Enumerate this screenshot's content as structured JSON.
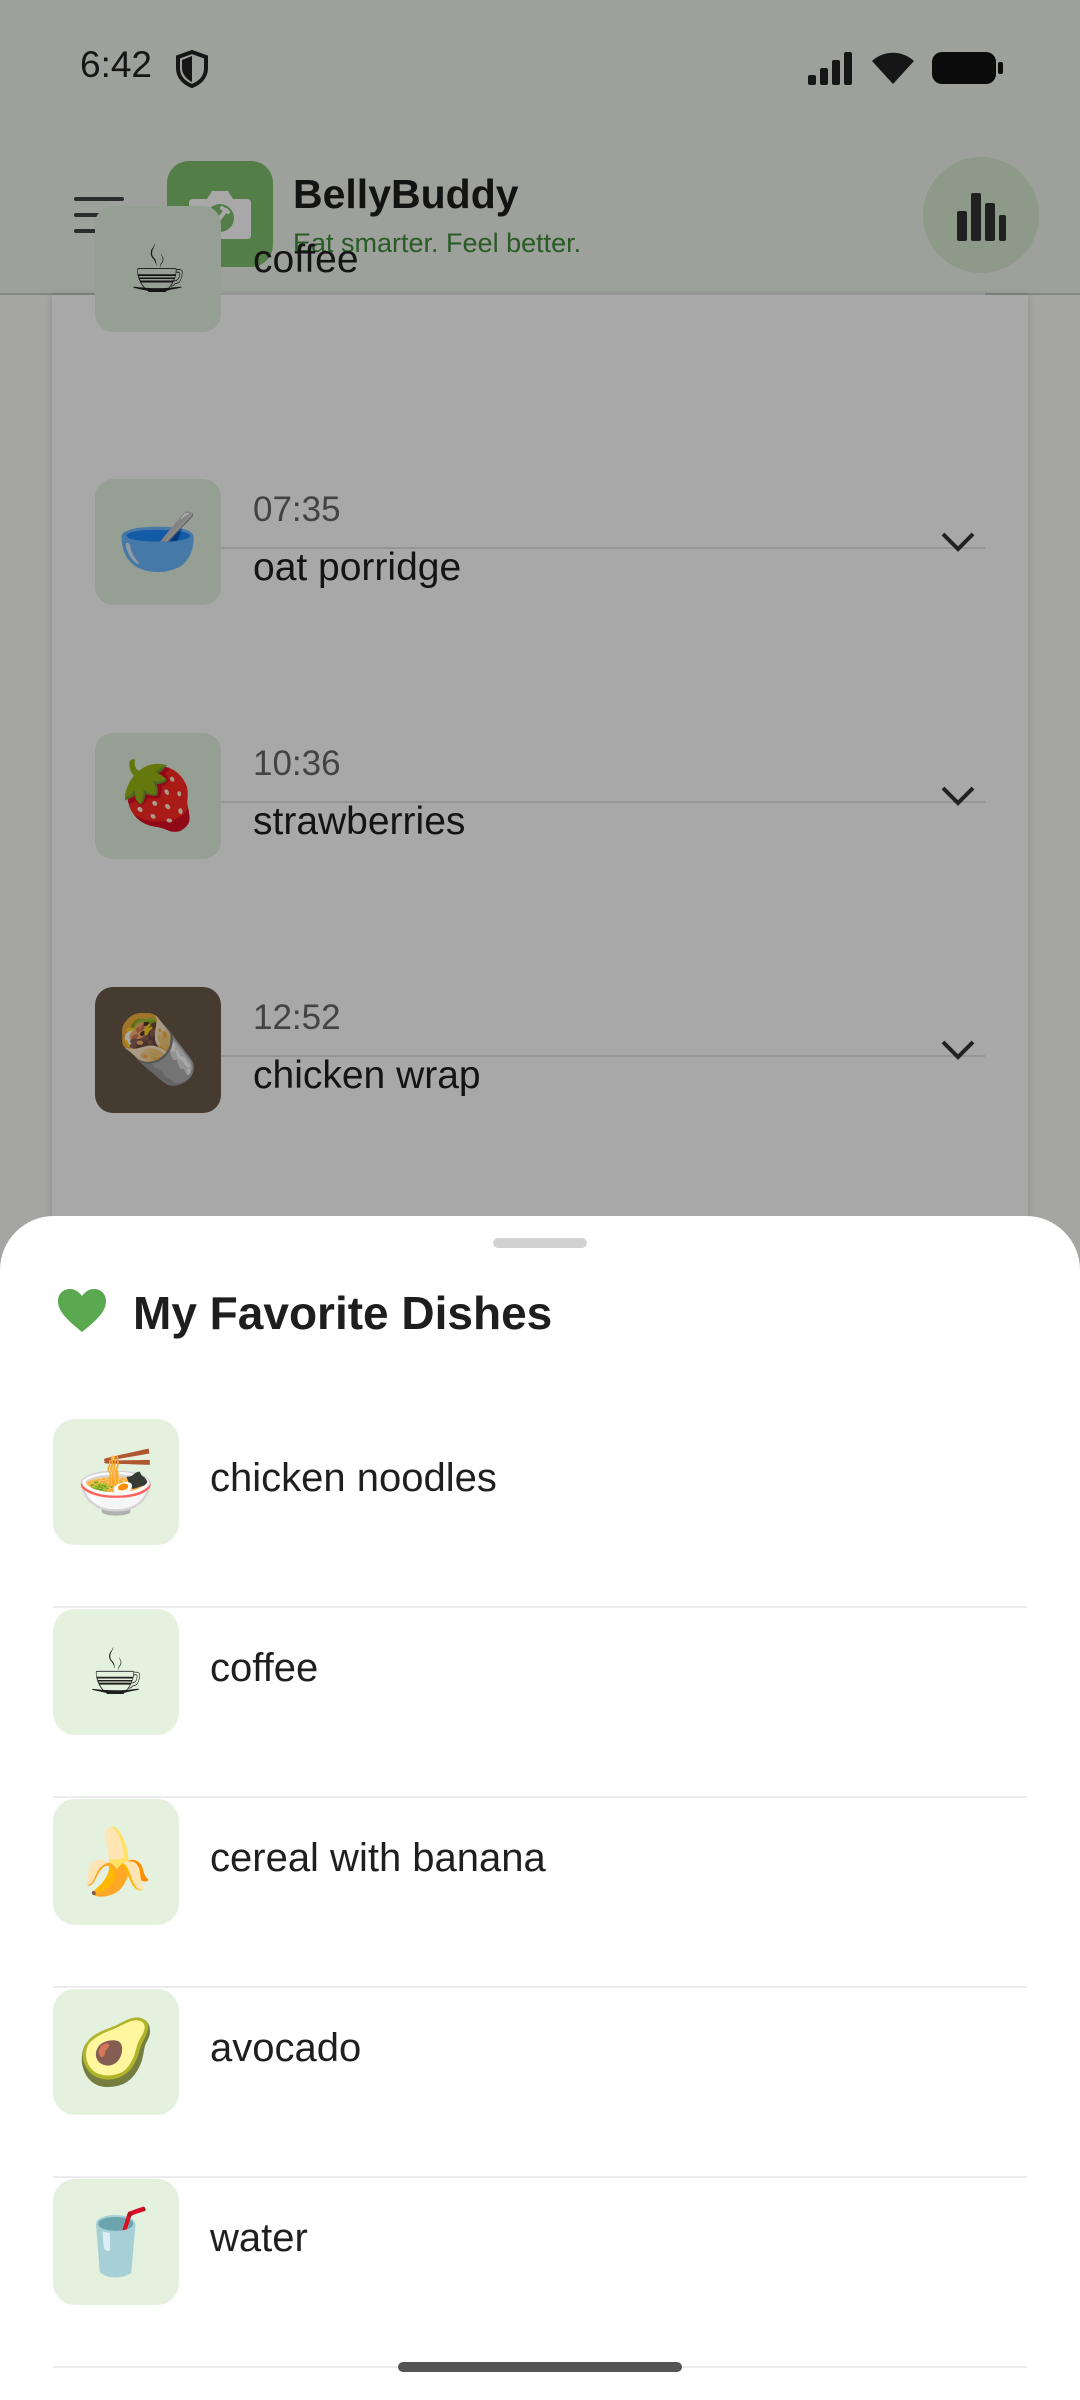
{
  "status_bar": {
    "time": "6:42",
    "shield_icon": "shield-icon",
    "signal_icon": "cell-signal-icon",
    "wifi_icon": "wifi-icon",
    "battery_icon": "battery-icon"
  },
  "app_bar": {
    "title": "BellyBuddy",
    "subtitle": "Eat smarter. Feel better.",
    "menu_icon": "hamburger-menu-icon",
    "logo_icon": "camera-fork-logo-icon",
    "stats_icon": "bar-chart-icon"
  },
  "meals": [
    {
      "time": "",
      "name": "coffee",
      "emoji": "☕"
    },
    {
      "time": "07:35",
      "name": "oat porridge",
      "emoji": "🥣"
    },
    {
      "time": "10:36",
      "name": "strawberries",
      "emoji": "🍓"
    },
    {
      "time": "12:52",
      "name": "chicken wrap",
      "emoji": "🌯"
    }
  ],
  "favorites_sheet": {
    "title": "My Favorite Dishes",
    "heart_icon": "heart-icon",
    "items": [
      {
        "label": "chicken noodles",
        "emoji": "🍜"
      },
      {
        "label": "coffee",
        "emoji": "☕"
      },
      {
        "label": "cereal with banana",
        "emoji": "🍌"
      },
      {
        "label": "avocado",
        "emoji": "🥑"
      },
      {
        "label": "water",
        "emoji": "🥤"
      }
    ]
  },
  "colors": {
    "accent": "#5aa84f",
    "accent_light": "#e4f1df",
    "subtitle": "#3d8a3a"
  }
}
